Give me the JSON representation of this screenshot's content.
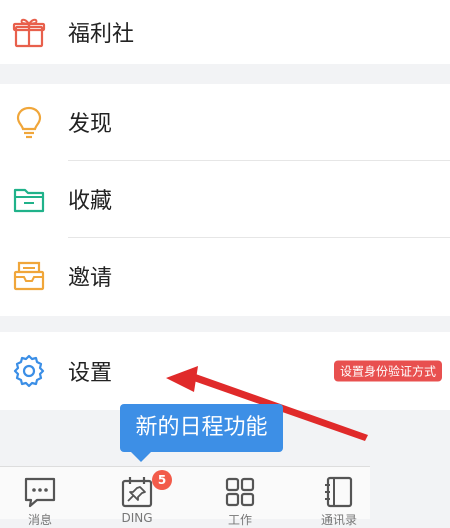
{
  "menu": {
    "welfare_label": "福利社",
    "discover_label": "发现",
    "favorites_label": "收藏",
    "invite_label": "邀请",
    "settings_label": "设置",
    "settings_badge": "设置身份验证方式"
  },
  "tooltip": {
    "text": "新的日程功能"
  },
  "tabbar": {
    "messages_label": "消息",
    "ding_label": "DING",
    "ding_count": "5",
    "work_label": "工作",
    "contacts_label": "通讯录"
  },
  "colors": {
    "welfare_icon": "#e8604c",
    "discover_icon": "#f0a63a",
    "favorites_icon": "#20b28a",
    "invite_icon": "#f0a63a",
    "settings_icon": "#3a8ee6",
    "badge": "#e8504f",
    "tooltip": "#3d8fe6",
    "arrow": "#e02a2a"
  },
  "icons": {
    "welfare": "gift-icon",
    "discover": "lightbulb-icon",
    "favorites": "folder-icon",
    "invite": "envelope-icon",
    "settings": "gear-icon",
    "messages": "chat-bubble-icon",
    "ding": "calendar-pin-icon",
    "work": "grid-icon",
    "contacts": "contact-book-icon"
  }
}
